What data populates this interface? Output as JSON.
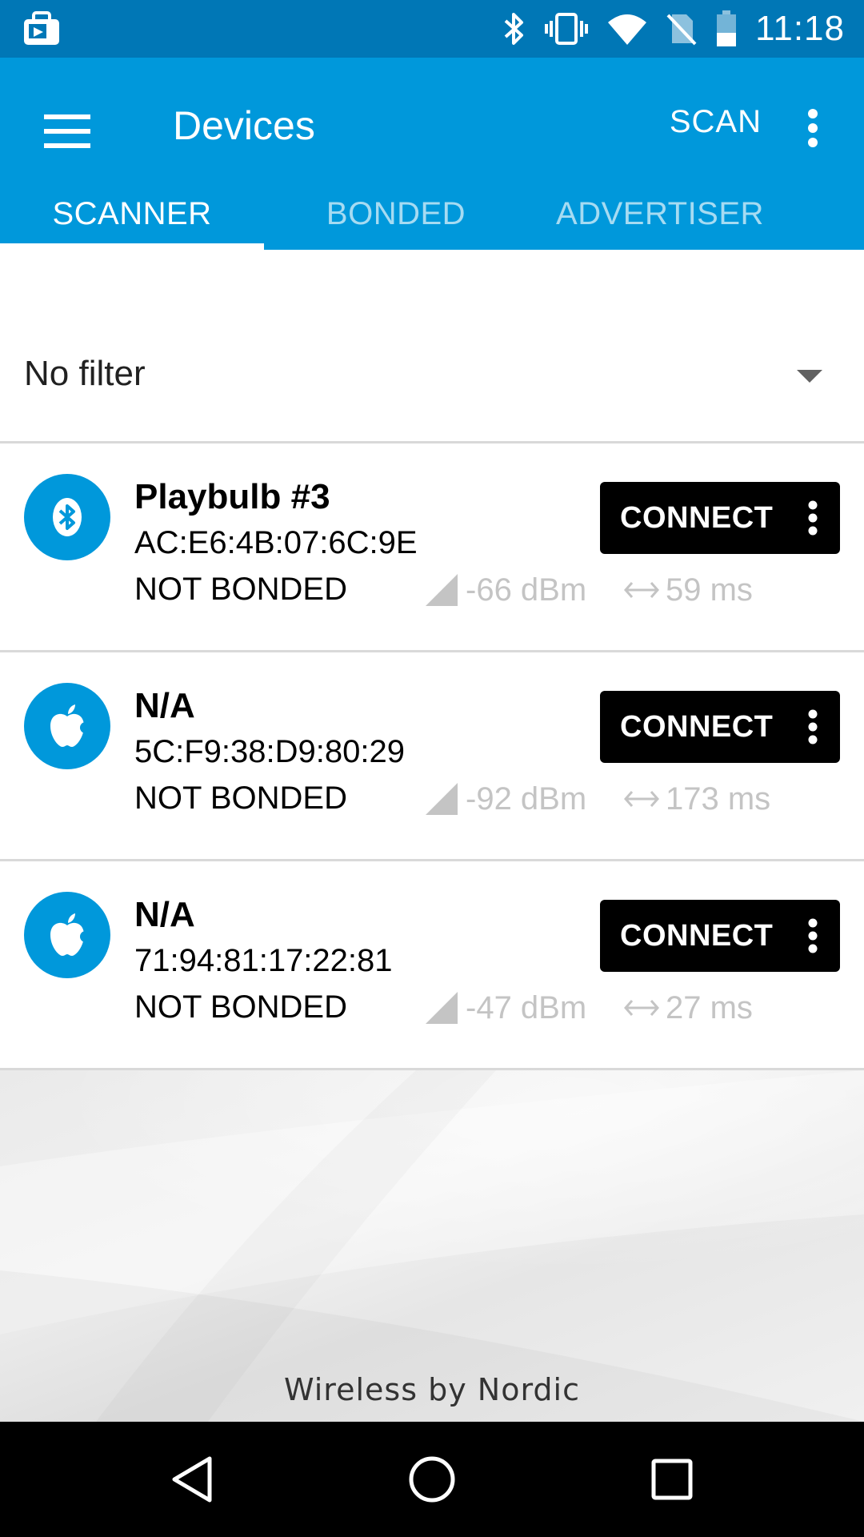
{
  "status_bar": {
    "time": "11:18",
    "icons": [
      "notification-icon",
      "bluetooth-icon",
      "vibrate-icon",
      "wifi-icon",
      "no-sim-icon",
      "battery-icon"
    ]
  },
  "app_bar": {
    "title": "Devices",
    "scan_label": "SCAN",
    "tabs": [
      {
        "label": "SCANNER",
        "active": true
      },
      {
        "label": "BONDED",
        "active": false
      },
      {
        "label": "ADVERTISER",
        "active": false
      }
    ],
    "color": "#0098db",
    "status_color": "#0077b6"
  },
  "filter": {
    "value": "No filter"
  },
  "devices": [
    {
      "icon": "bluetooth-icon",
      "name": "Playbulb #3",
      "address": "AC:E6:4B:07:6C:9E",
      "bond_state": "NOT BONDED",
      "rssi": "-66 dBm",
      "interval": "59 ms",
      "action_label": "CONNECT"
    },
    {
      "icon": "apple-icon",
      "name": "N/A",
      "address": "5C:F9:38:D9:80:29",
      "bond_state": "NOT BONDED",
      "rssi": "-92 dBm",
      "interval": "173 ms",
      "action_label": "CONNECT"
    },
    {
      "icon": "apple-icon",
      "name": "N/A",
      "address": "71:94:81:17:22:81",
      "bond_state": "NOT BONDED",
      "rssi": "-47 dBm",
      "interval": "27 ms",
      "action_label": "CONNECT"
    }
  ],
  "footer": {
    "text": "Wireless by Nordic"
  }
}
